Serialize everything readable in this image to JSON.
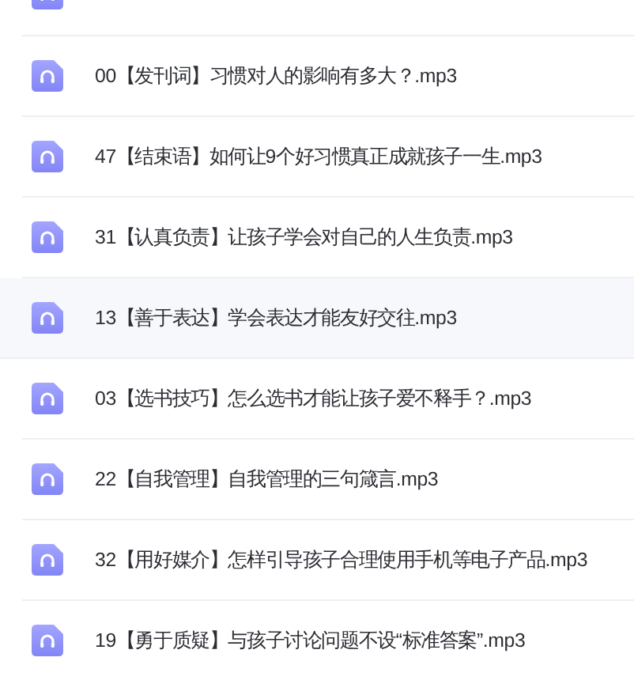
{
  "files": [
    {
      "name": "00【发刊词】习惯对人的影响有多大？.mp3",
      "selected": false
    },
    {
      "name": "47【结束语】如何让9个好习惯真正成就孩子一生.mp3",
      "selected": false
    },
    {
      "name": "31【认真负责】让孩子学会对自己的人生负责.mp3",
      "selected": false
    },
    {
      "name": "13【善于表达】学会表达才能友好交往.mp3",
      "selected": true
    },
    {
      "name": "03【选书技巧】怎么选书才能让孩子爱不释手？.mp3",
      "selected": false
    },
    {
      "name": "22【自我管理】自我管理的三句箴言.mp3",
      "selected": false
    },
    {
      "name": "32【用好媒介】怎样引导孩子合理使用手机等电子产品.mp3",
      "selected": false
    },
    {
      "name": "19【勇于质疑】与孩子讨论问题不设“标准答案”.mp3",
      "selected": false
    }
  ]
}
